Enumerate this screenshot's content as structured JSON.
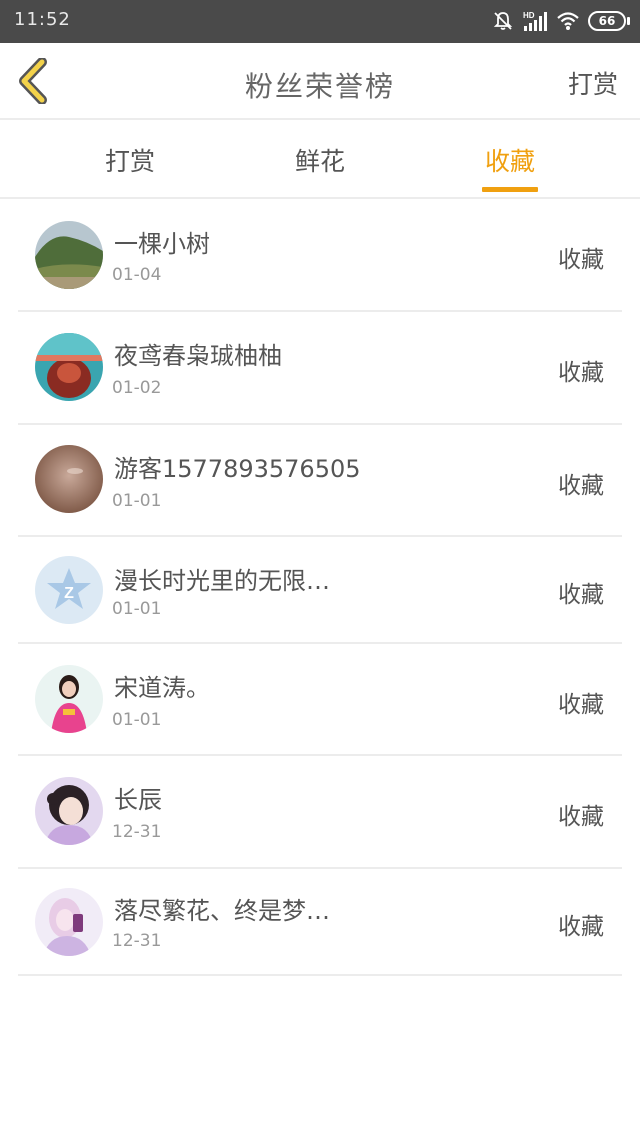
{
  "status": {
    "time": "11:52",
    "battery": "66",
    "net": "HD"
  },
  "header": {
    "title": "粉丝荣誉榜",
    "action": "打赏"
  },
  "tabs": [
    {
      "label": "打赏"
    },
    {
      "label": "鲜花"
    },
    {
      "label": "收藏",
      "active": true
    }
  ],
  "accent_color": "#f0a010",
  "rows": [
    {
      "name": "一棵小树",
      "date": "01-04",
      "action": "收藏",
      "avatar": "landscape-photo"
    },
    {
      "name": "夜鸢春枭珹柚柚",
      "date": "01-02",
      "action": "收藏",
      "avatar": "flowers-photo"
    },
    {
      "name": "游客1577893576505",
      "date": "01-01",
      "action": "收藏",
      "avatar": "blurred-photo"
    },
    {
      "name": "漫长时光里的无限…",
      "date": "01-01",
      "action": "收藏",
      "avatar": "qq-default-icon"
    },
    {
      "name": "宋道涛。",
      "date": "01-01",
      "action": "收藏",
      "avatar": "girl-pink-photo"
    },
    {
      "name": "长辰",
      "date": "12-31",
      "action": "收藏",
      "avatar": "girl-illustration"
    },
    {
      "name": "落尽繁花、终是梦…",
      "date": "12-31",
      "action": "收藏",
      "avatar": "girl-purple-photo"
    }
  ]
}
